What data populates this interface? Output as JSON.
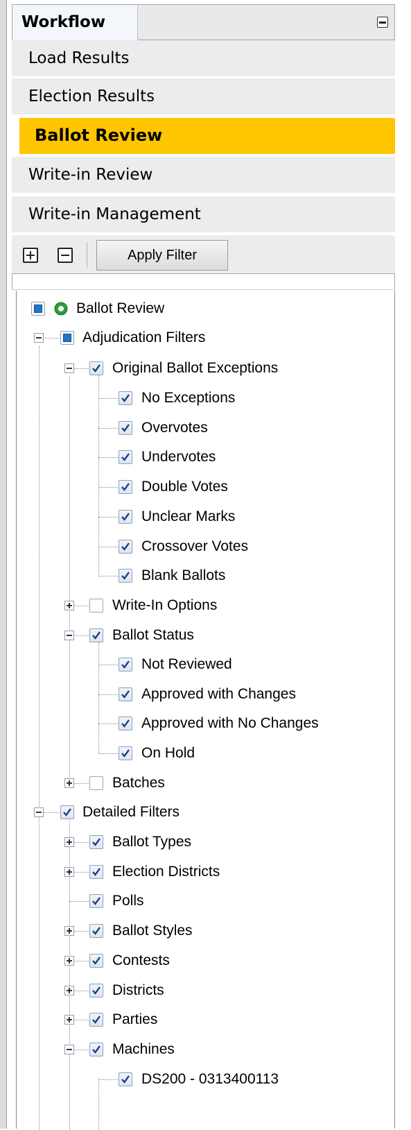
{
  "panel": {
    "tab_label": "Workflow"
  },
  "nav": {
    "items": [
      "Load Results",
      "Election Results",
      "Ballot Review",
      "Write-in Review",
      "Write-in Management"
    ],
    "active_index": 2,
    "active_color": "#ffc600"
  },
  "toolbar": {
    "apply_filter_label": "Apply Filter"
  },
  "tree": {
    "root_label": "Ballot Review",
    "adjudication_filters": "Adjudication Filters",
    "original_ballot_exceptions": "Original Ballot Exceptions",
    "exceptions": [
      "No Exceptions",
      "Overvotes",
      "Undervotes",
      "Double Votes",
      "Unclear Marks",
      "Crossover Votes",
      "Blank Ballots"
    ],
    "write_in_options": "Write-In Options",
    "ballot_status": "Ballot Status",
    "statuses": [
      "Not Reviewed",
      "Approved with Changes",
      "Approved with No Changes",
      "On Hold"
    ],
    "batches": "Batches",
    "detailed_filters": "Detailed Filters",
    "detail_items": [
      "Ballot Types",
      "Election Districts",
      "Polls",
      "Ballot Styles",
      "Contests",
      "Districts",
      "Parties",
      "Machines"
    ],
    "machines": [
      "DS200 - 0313400113"
    ]
  }
}
